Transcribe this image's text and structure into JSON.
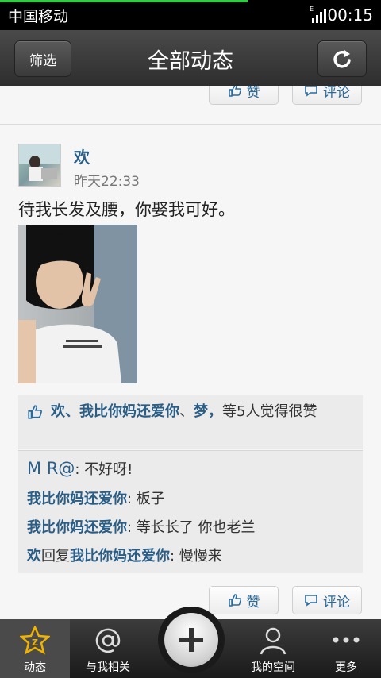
{
  "status_bar": {
    "carrier": "中国移动",
    "time": "00:15"
  },
  "header": {
    "title": "全部动态",
    "filter_label": "筛选"
  },
  "top_actions": {
    "like_label": "赞",
    "comment_label": "评论"
  },
  "post": {
    "username": "欢",
    "time": "昨天22:33",
    "text": "待我长发及腰，你娶我可好。",
    "likes": {
      "user1": "欢",
      "sep1": "、",
      "user2": "我比你妈还爱你",
      "sep2": "、",
      "user3": "梦，",
      "suffix": "等5人觉得很赞"
    },
    "comments": [
      {
        "author": "M R@",
        "text": ": 不好呀!"
      },
      {
        "author": "我比你妈还爱你",
        "text": ": 板子"
      },
      {
        "author": "我比你妈还爱你",
        "text": ": 等长长了 你也老兰"
      },
      {
        "author": "欢",
        "reply_word": "回复",
        "target": "我比你妈还爱你",
        "text": ": 慢慢来"
      }
    ],
    "like_label": "赞",
    "comment_label": "评论"
  },
  "tabbar": {
    "tabs": [
      {
        "label": "动态",
        "icon": "star-icon",
        "active": true
      },
      {
        "label": "与我相关",
        "icon": "at-icon"
      },
      {
        "label": "我的空间",
        "icon": "person-icon"
      },
      {
        "label": "更多",
        "icon": "more-icon"
      }
    ],
    "center_icon": "plus-icon"
  },
  "colors": {
    "link": "#2a5e86",
    "header": "#3a3a3a"
  }
}
